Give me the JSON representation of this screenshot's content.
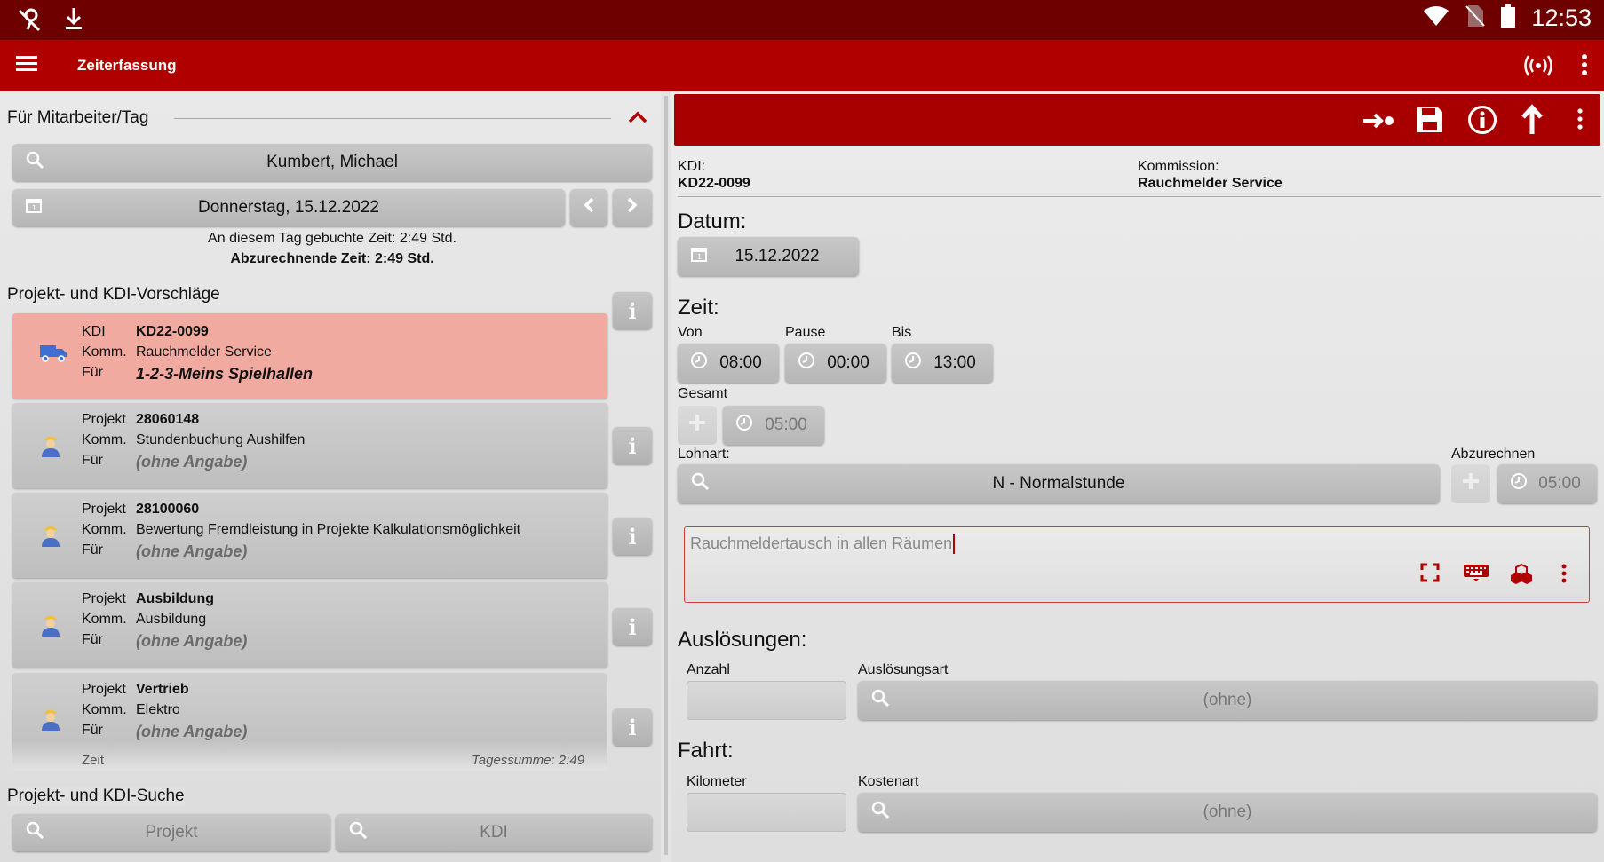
{
  "status": {
    "time": "12:53"
  },
  "appbar": {
    "title": "Zeiterfassung"
  },
  "left": {
    "section_title": "Für Mitarbeiter/Tag",
    "employee": "Kumbert, Michael",
    "date": "Donnerstag, 15.12.2022",
    "booked_time": "An diesem Tag gebuchte Zeit: 2:49 Std.",
    "billable_time": "Abzurechnende Zeit: 2:49 Std.",
    "suggestions_title": "Projekt- und KDI-Vorschläge",
    "cards": [
      {
        "type_label": "KDI",
        "id": "KD22-0099",
        "komm_label": "Komm.",
        "komm": "Rauchmelder Service",
        "fuer_label": "Für",
        "fuer": "1-2-3-Meins Spielhallen"
      },
      {
        "type_label": "Projekt",
        "id": "28060148",
        "komm_label": "Komm.",
        "komm": "Stundenbuchung Aushilfen",
        "fuer_label": "Für",
        "fuer": "(ohne Angabe)"
      },
      {
        "type_label": "Projekt",
        "id": "28100060",
        "komm_label": "Komm.",
        "komm": "Bewertung Fremdleistung in Projekte Kalkulationsmöglichkeit",
        "fuer_label": "Für",
        "fuer": "(ohne Angabe)"
      },
      {
        "type_label": "Projekt",
        "id": "Ausbildung",
        "komm_label": "Komm.",
        "komm": "Ausbildung",
        "fuer_label": "Für",
        "fuer": "(ohne Angabe)"
      },
      {
        "type_label": "Projekt",
        "id": "Vertrieb",
        "komm_label": "Komm.",
        "komm": "Elektro",
        "fuer_label": "Für",
        "fuer": "(ohne Angabe)"
      }
    ],
    "peek": {
      "zeit": "Zeit",
      "tagessumme": "Tagessumme: 2:49"
    },
    "search_title": "Projekt- und KDI-Suche",
    "search_projekt": "Projekt",
    "search_kdi": "KDI"
  },
  "right": {
    "kdi_label": "KDI:",
    "kdi_value": "KD22-0099",
    "kommission_label": "Kommission:",
    "kommission_value": "Rauchmelder Service",
    "datum_title": "Datum:",
    "datum_value": "15.12.2022",
    "zeit_title": "Zeit:",
    "von_label": "Von",
    "von_value": "08:00",
    "pause_label": "Pause",
    "pause_value": "00:00",
    "bis_label": "Bis",
    "bis_value": "13:00",
    "gesamt_label": "Gesamt",
    "gesamt_value": "05:00",
    "lohnart_label": "Lohnart:",
    "lohnart_value": "N - Normalstunde",
    "abzurechnen_label": "Abzurechnen",
    "abzurechnen_value": "05:00",
    "notes_placeholder": "Rauchmeldertausch in allen Räumen",
    "ausloesungen_title": "Auslösungen:",
    "anzahl_label": "Anzahl",
    "ausloesungsart_label": "Auslösungsart",
    "ausloesungsart_value": "(ohne)",
    "fahrt_title": "Fahrt:",
    "kilometer_label": "Kilometer",
    "kostenart_label": "Kostenart",
    "kostenart_value": "(ohne)"
  },
  "colors": {
    "statusbar": "#6e0000",
    "appbar": "#b10000",
    "toolbar": "#a80000",
    "active_card": "#f1aaa0"
  }
}
